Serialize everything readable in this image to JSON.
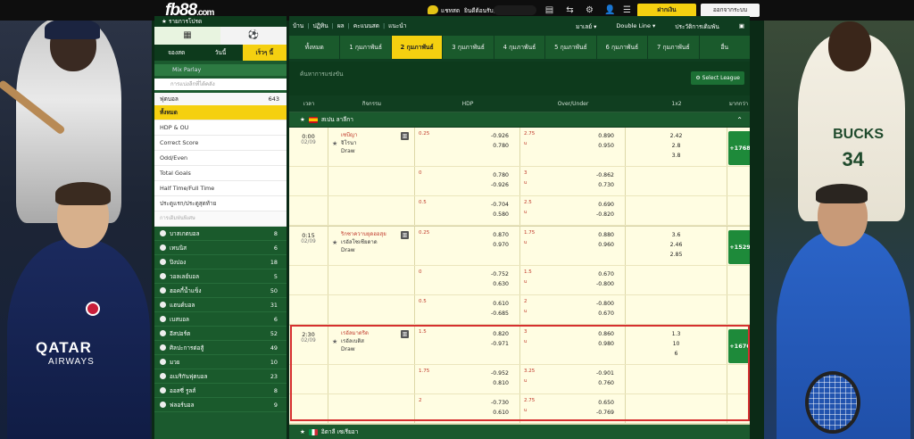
{
  "brand": {
    "logo_main": "fb88",
    "logo_suffix": ".com"
  },
  "topbar": {
    "chat_label": "แชทสด",
    "welcome_label": "ยินดีต้อนรับ,",
    "deposit_button": "ฝากเงิน",
    "logout_button": "ออกจากระบบ"
  },
  "sidebar": {
    "header": "รายการโปรด",
    "tabs": [
      "จองสด",
      "วันนี้",
      "เร็วๆ นี้"
    ],
    "mix_parlay": "Mix Parlay",
    "search_placeholder": "การแบ่งลีกที่ได้คลัง",
    "football": {
      "label": "ฟุตบอล",
      "count": "643"
    },
    "bet_types": [
      "ทั้งหมด",
      "HDP & OU",
      "Correct Score",
      "Odd/Even",
      "Total Goals",
      "Half Time/Full Time",
      "ประตูแรก/ประตูสุดท้าย",
      "การเดิมพันพิเศษ"
    ],
    "sports": [
      {
        "name": "บาสเกตบอล",
        "count": "8"
      },
      {
        "name": "เทนนิส",
        "count": "6"
      },
      {
        "name": "ปิงปอง",
        "count": "18"
      },
      {
        "name": "วอลเลย์บอล",
        "count": "5"
      },
      {
        "name": "ฮอคกี้น้ำแข็ง",
        "count": "50"
      },
      {
        "name": "แฮนด์บอล",
        "count": "31"
      },
      {
        "name": "เบสบอล",
        "count": "6"
      },
      {
        "name": "อีสปอร์ต",
        "count": "52"
      },
      {
        "name": "ศิลปะการต่อสู้",
        "count": "49"
      },
      {
        "name": "มวย",
        "count": "10"
      },
      {
        "name": "อเมริกันฟุตบอล",
        "count": "23"
      },
      {
        "name": "ออสซี่ รูลส์",
        "count": "8"
      },
      {
        "name": "ฟลอร์บอล",
        "count": "9"
      }
    ]
  },
  "nav": {
    "links": [
      "บ้าน",
      "ปฏิทิน",
      "ผล",
      "คะแนนสด",
      "แนะนำ"
    ],
    "odds_format": "มาเลย์ ▾",
    "line_mode": "Double Line ▾",
    "history": "ประวัติการเดิมพัน"
  },
  "date_tabs": [
    "ทั้งหมด",
    "1 กุมภาพันธ์",
    "2 กุมภาพันธ์",
    "3 กุมภาพันธ์",
    "4 กุมภาพันธ์",
    "5 กุมภาพันธ์",
    "6 กุมภาพันธ์",
    "7 กุมภาพันธ์",
    "อื่น"
  ],
  "section": {
    "title": "ค้นหาการแข่งขัน",
    "select_league": "Select League"
  },
  "columns": [
    "เวลา",
    "กิจกรรม",
    "HDP",
    "Over/Under",
    "1x2",
    "มากกว่า"
  ],
  "leagues": [
    {
      "name": "สเปน ลาลีกา",
      "matches": [
        {
          "time": "0:00",
          "date": "02/09",
          "home": "เซบีญา",
          "away": "จิโรนา",
          "draw": "Draw",
          "more": "+1768",
          "lines": [
            {
              "hdp_line": "0.25",
              "hdp_home": "-0.926",
              "hdp_away": "0.780",
              "ou_line": "2.75",
              "ou_u": "u",
              "ou_over": "0.890",
              "ou_under": "0.950",
              "x": [
                "2.42",
                "2.8",
                "3.8"
              ]
            },
            {
              "hdp_line": "0",
              "hdp_home": "0.780",
              "hdp_away": "-0.926",
              "ou_line": "3",
              "ou_u": "u",
              "ou_over": "-0.862",
              "ou_under": "0.730",
              "x": []
            },
            {
              "hdp_line": "0.5",
              "hdp_home": "-0.704",
              "hdp_away": "0.580",
              "ou_line": "2.5",
              "ou_u": "u",
              "ou_over": "0.690",
              "ou_under": "-0.820",
              "x": []
            }
          ]
        },
        {
          "time": "0:15",
          "date": "02/09",
          "home": "ริกซาควาบยุดฮอสุย",
          "away": "เรอัลโซเซียดาด",
          "draw": "Draw",
          "more": "+1529",
          "lines": [
            {
              "hdp_line": "0.25",
              "hdp_home": "0.870",
              "hdp_away": "0.970",
              "ou_line": "1.75",
              "ou_u": "u",
              "ou_over": "0.880",
              "ou_under": "0.960",
              "x": [
                "3.6",
                "2.46",
                "2.85"
              ]
            },
            {
              "hdp_line": "0",
              "hdp_home": "-0.752",
              "hdp_away": "0.630",
              "ou_line": "1.5",
              "ou_u": "u",
              "ou_over": "0.670",
              "ou_under": "-0.800",
              "x": []
            },
            {
              "hdp_line": "0.5",
              "hdp_home": "0.610",
              "hdp_away": "-0.685",
              "ou_line": "2",
              "ou_u": "u",
              "ou_over": "-0.800",
              "ou_under": "0.670",
              "x": []
            }
          ]
        },
        {
          "time": "2:30",
          "date": "02/09",
          "home": "เรอัลมาดริด",
          "away": "เรอัลเบติส",
          "draw": "Draw",
          "more": "+1676",
          "lines": [
            {
              "hdp_line": "1.5",
              "hdp_home": "0.820",
              "hdp_away": "-0.971",
              "ou_line": "3",
              "ou_u": "u",
              "ou_over": "0.860",
              "ou_under": "0.980",
              "x": [
                "1.3",
                "10",
                "6"
              ]
            },
            {
              "hdp_line": "1.75",
              "hdp_home": "-0.952",
              "hdp_away": "0.810",
              "ou_line": "3.25",
              "ou_u": "u",
              "ou_over": "-0.901",
              "ou_under": "0.760",
              "x": []
            },
            {
              "hdp_line": "2",
              "hdp_home": "-0.730",
              "hdp_away": "0.610",
              "ou_line": "2.75",
              "ou_u": "u",
              "ou_over": "0.650",
              "ou_under": "-0.769",
              "x": []
            }
          ]
        }
      ]
    },
    {
      "name": "อิตาลี เซเรียอา",
      "matches": []
    }
  ],
  "side_art": {
    "left_jersey_text": "QATAR",
    "left_jersey_sub": "AIRWAYS",
    "right_jersey_text": "BUCKS",
    "right_jersey_num": "34"
  }
}
